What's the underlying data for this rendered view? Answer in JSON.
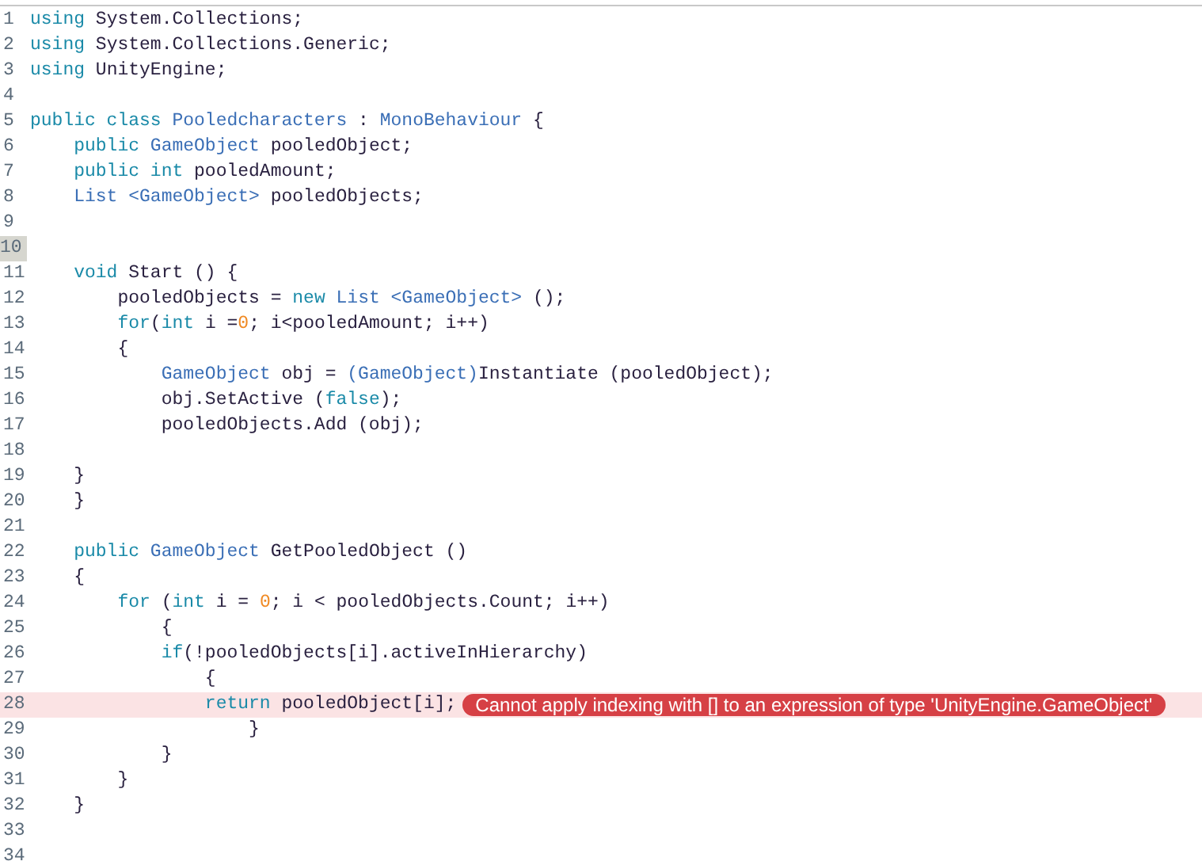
{
  "lines": [
    {
      "number": "1",
      "current": false,
      "tokens": [
        {
          "kind": "keyword",
          "text": "using"
        },
        {
          "kind": "plain",
          "text": " System.Collections;"
        }
      ]
    },
    {
      "number": "2",
      "current": false,
      "tokens": [
        {
          "kind": "keyword",
          "text": "using"
        },
        {
          "kind": "plain",
          "text": " System.Collections.Generic;"
        }
      ]
    },
    {
      "number": "3",
      "current": false,
      "tokens": [
        {
          "kind": "keyword",
          "text": "using"
        },
        {
          "kind": "plain",
          "text": " UnityEngine;"
        }
      ]
    },
    {
      "number": "4",
      "current": false
    },
    {
      "number": "5",
      "current": false,
      "tokens": [
        {
          "kind": "keyword",
          "text": "public class "
        },
        {
          "kind": "type",
          "text": "Pooledcharacters"
        },
        {
          "kind": "plain",
          "text": " : "
        },
        {
          "kind": "type",
          "text": "MonoBehaviour"
        },
        {
          "kind": "plain",
          "text": " {"
        }
      ]
    },
    {
      "number": "6",
      "current": false,
      "tokens": [
        {
          "kind": "keyword",
          "text": "    public "
        },
        {
          "kind": "type",
          "text": "GameObject"
        },
        {
          "kind": "plain",
          "text": " pooledObject;"
        }
      ]
    },
    {
      "number": "7",
      "current": false,
      "tokens": [
        {
          "kind": "keyword",
          "text": "    public int"
        },
        {
          "kind": "plain",
          "text": " pooledAmount;"
        }
      ]
    },
    {
      "number": "8",
      "current": false,
      "tokens": [
        {
          "kind": "type",
          "text": "    List <GameObject>"
        },
        {
          "kind": "plain",
          "text": " pooledObjects;"
        }
      ]
    },
    {
      "number": "9",
      "current": false
    },
    {
      "number": "10",
      "current": true
    },
    {
      "number": "11",
      "current": false,
      "tokens": [
        {
          "kind": "keyword",
          "text": "    void"
        },
        {
          "kind": "plain",
          "text": " Start () {"
        }
      ]
    },
    {
      "number": "12",
      "current": false,
      "tokens": [
        {
          "kind": "plain",
          "text": "        pooledObjects = "
        },
        {
          "kind": "keyword",
          "text": "new"
        },
        {
          "kind": "type",
          "text": " List <GameObject>"
        },
        {
          "kind": "plain",
          "text": " ();"
        }
      ]
    },
    {
      "number": "13",
      "current": false,
      "tokens": [
        {
          "kind": "keyword",
          "text": "        for"
        },
        {
          "kind": "plain",
          "text": "("
        },
        {
          "kind": "keyword",
          "text": "int"
        },
        {
          "kind": "plain",
          "text": " i ="
        },
        {
          "kind": "number",
          "text": "0"
        },
        {
          "kind": "plain",
          "text": "; i<pooledAmount; i++)"
        }
      ]
    },
    {
      "number": "14",
      "current": false,
      "tokens": [
        {
          "kind": "plain",
          "text": "        {"
        }
      ]
    },
    {
      "number": "15",
      "current": false,
      "tokens": [
        {
          "kind": "type",
          "text": "            GameObject"
        },
        {
          "kind": "plain",
          "text": " obj = "
        },
        {
          "kind": "type",
          "text": "(GameObject)"
        },
        {
          "kind": "plain",
          "text": "Instantiate (pooledObject);"
        }
      ]
    },
    {
      "number": "16",
      "current": false,
      "tokens": [
        {
          "kind": "plain",
          "text": "            obj.SetActive ("
        },
        {
          "kind": "keyword",
          "text": "false"
        },
        {
          "kind": "plain",
          "text": ");"
        }
      ]
    },
    {
      "number": "17",
      "current": false,
      "tokens": [
        {
          "kind": "plain",
          "text": "            pooledObjects.Add (obj);"
        }
      ]
    },
    {
      "number": "18",
      "current": false
    },
    {
      "number": "19",
      "current": false,
      "tokens": [
        {
          "kind": "plain",
          "text": "    }"
        }
      ]
    },
    {
      "number": "20",
      "current": false,
      "tokens": [
        {
          "kind": "plain",
          "text": "    }"
        }
      ]
    },
    {
      "number": "21",
      "current": false
    },
    {
      "number": "22",
      "current": false,
      "tokens": [
        {
          "kind": "keyword",
          "text": "    public "
        },
        {
          "kind": "type",
          "text": "GameObject"
        },
        {
          "kind": "plain",
          "text": " GetPooledObject ()"
        }
      ]
    },
    {
      "number": "23",
      "current": false,
      "tokens": [
        {
          "kind": "plain",
          "text": "    {"
        }
      ]
    },
    {
      "number": "24",
      "current": false,
      "tokens": [
        {
          "kind": "keyword",
          "text": "        for"
        },
        {
          "kind": "plain",
          "text": " ("
        },
        {
          "kind": "keyword",
          "text": "int"
        },
        {
          "kind": "plain",
          "text": " i = "
        },
        {
          "kind": "number",
          "text": "0"
        },
        {
          "kind": "plain",
          "text": "; i < pooledObjects.Count; i++)"
        }
      ]
    },
    {
      "number": "25",
      "current": false,
      "tokens": [
        {
          "kind": "plain",
          "text": "            {"
        }
      ]
    },
    {
      "number": "26",
      "current": false,
      "tokens": [
        {
          "kind": "keyword",
          "text": "            if"
        },
        {
          "kind": "plain",
          "text": "(!pooledObjects[i].activeInHierarchy)"
        }
      ]
    },
    {
      "number": "27",
      "current": false,
      "tokens": [
        {
          "kind": "plain",
          "text": "                {"
        }
      ]
    },
    {
      "number": "28",
      "current": false,
      "tokens": [
        {
          "kind": "keyword",
          "text": "                return"
        },
        {
          "kind": "plain",
          "text": " pooledObject[i];"
        }
      ],
      "error": "Cannot apply indexing with [] to an expression of type 'UnityEngine.GameObject'"
    },
    {
      "number": "29",
      "current": false,
      "tokens": [
        {
          "kind": "plain",
          "text": "                    }"
        }
      ]
    },
    {
      "number": "30",
      "current": false,
      "tokens": [
        {
          "kind": "plain",
          "text": "            }"
        }
      ]
    },
    {
      "number": "31",
      "current": false,
      "tokens": [
        {
          "kind": "plain",
          "text": "        }"
        }
      ]
    },
    {
      "number": "32",
      "current": false,
      "tokens": [
        {
          "kind": "plain",
          "text": "    }"
        }
      ]
    },
    {
      "number": "33",
      "current": false
    },
    {
      "number": "34",
      "current": false
    }
  ]
}
